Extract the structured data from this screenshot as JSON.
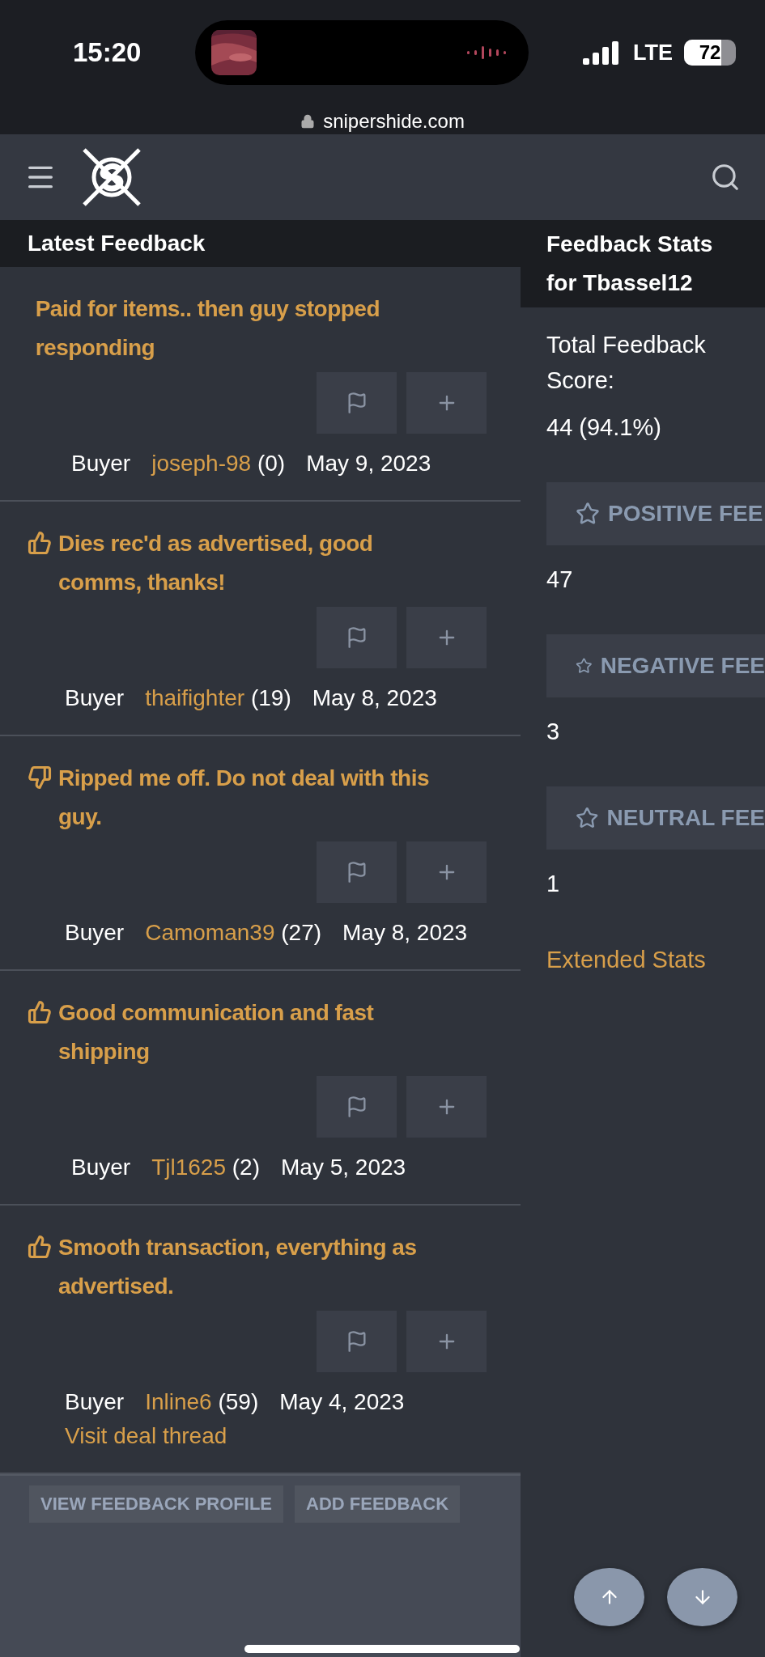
{
  "status_bar": {
    "time": "15:20",
    "network": "LTE",
    "battery": "72"
  },
  "browser": {
    "url": "snipershide.com"
  },
  "feedback": {
    "title": "Latest Feedback",
    "items": [
      {
        "kind": "neutral",
        "title": "Paid for items.. then guy stopped responding",
        "role": "Buyer",
        "user": "joseph-98",
        "count": "(0)",
        "date": "May 9, 2023"
      },
      {
        "kind": "positive",
        "title": "Dies rec'd as advertised, good comms, thanks!",
        "role": "Buyer",
        "user": "thaifighter",
        "count": "(19)",
        "date": "May 8, 2023"
      },
      {
        "kind": "negative",
        "title": "Ripped me off. Do not deal with this guy.",
        "role": "Buyer",
        "user": "Camoman39",
        "count": "(27)",
        "date": "May 8, 2023"
      },
      {
        "kind": "positive",
        "title": "Good communication and fast shipping",
        "role": "Buyer",
        "user": "Tjl1625",
        "count": "(2)",
        "date": "May 5, 2023"
      },
      {
        "kind": "positive",
        "title": "Smooth transaction, everything as advertised.",
        "role": "Buyer",
        "user": "Inline6",
        "count": "(59)",
        "date": "May 4, 2023",
        "link": "Visit deal thread"
      }
    ],
    "footer_buttons": [
      "VIEW FEEDBACK PROFILE",
      "ADD FEEDBACK"
    ]
  },
  "stats": {
    "title": "Feedback Stats for Tbassel12",
    "total_label": "Total Feedback Score:",
    "total_value": "44 (94.1%)",
    "groups": [
      {
        "label": "POSITIVE FEE",
        "value": "47"
      },
      {
        "label": "NEGATIVE FEE",
        "value": "3"
      },
      {
        "label": "NEUTRAL FEE",
        "value": "1"
      }
    ],
    "link": "Extended Stats"
  }
}
